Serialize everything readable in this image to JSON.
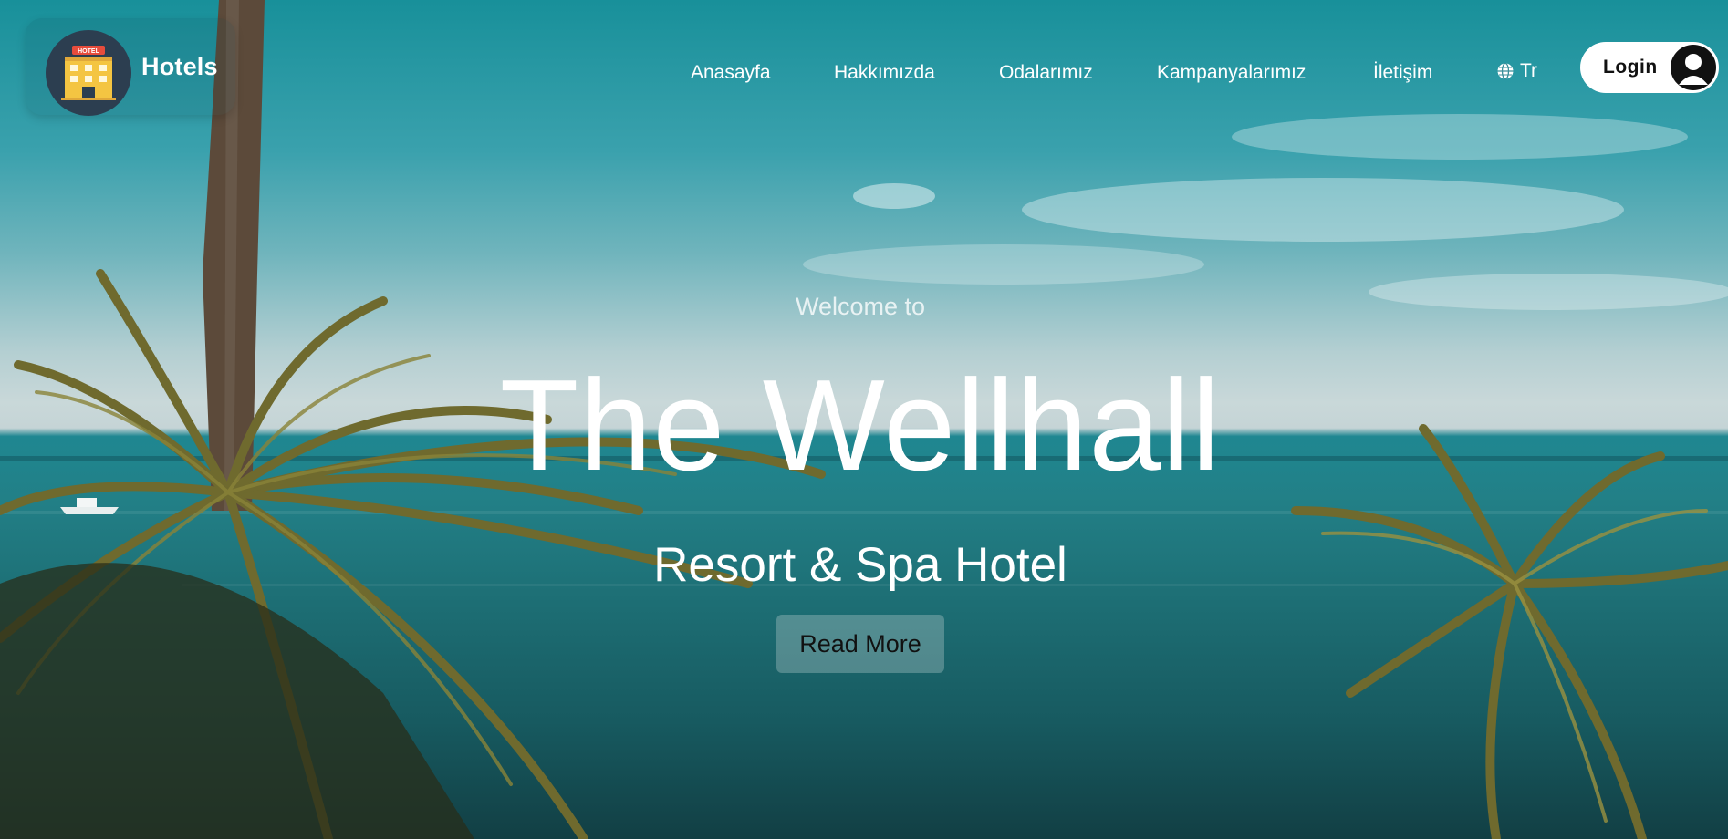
{
  "nav": {
    "brand": "Hotels",
    "logo_sign": "HOTEL",
    "items": [
      {
        "label": "Anasayfa"
      },
      {
        "label": "Hakkımızda"
      },
      {
        "label": "Odalarımız"
      },
      {
        "label": "Kampanyalarımız"
      },
      {
        "label": "İletişim"
      }
    ],
    "language": {
      "icon": "globe-icon",
      "label": "Tr"
    },
    "login": {
      "label": "Login",
      "icon": "user-avatar-icon"
    }
  },
  "hero": {
    "welcome": "Welcome to",
    "title": "The Wellhall",
    "subtitle": "Resort & Spa Hotel",
    "cta": "Read More"
  },
  "colors": {
    "logo_bg": "#2c3e50",
    "login_bg": "#ffffff",
    "text": "#ffffff"
  }
}
